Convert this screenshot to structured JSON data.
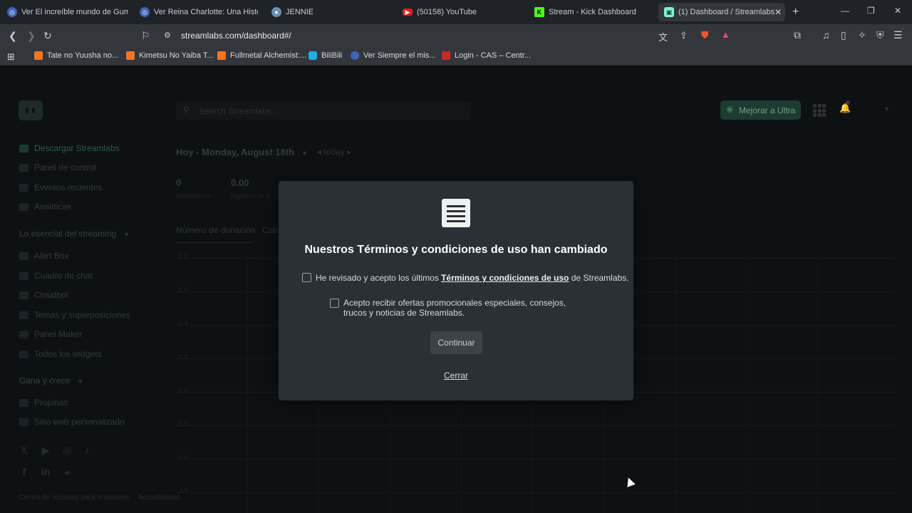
{
  "browser": {
    "tabs": [
      {
        "title": "Ver El increíble mundo de Gumb",
        "active": false
      },
      {
        "title": "Ver Reina Charlotte: Una Historia",
        "active": false
      },
      {
        "title": "JENNIE",
        "active": false
      },
      {
        "title": "(50158) YouTube",
        "active": false
      },
      {
        "title": "Stream - Kick Dashboard",
        "active": false
      },
      {
        "title": "(1) Dashboard / Streamlabs",
        "active": true
      }
    ],
    "url": "streamlabs.com/dashboard#/",
    "bookmarks": [
      "Tate no Yuusha no...",
      "Kimetsu No Yaiba T...",
      "Fullmetal Alchemist:...",
      "BiliBili",
      "Ver Siempre el mis...",
      "Login - CAS – Centr..."
    ]
  },
  "header": {
    "search_placeholder": "Search Streamlabs ...",
    "upgrade_label": "Mejorar a Ultra"
  },
  "sidebar": {
    "top_items": [
      {
        "label": "Descargar Streamlabs",
        "highlight": true
      },
      {
        "label": "Panel de control",
        "highlight": false
      },
      {
        "label": "Eventos recientes",
        "highlight": false
      },
      {
        "label": "Analíticas",
        "highlight": false
      }
    ],
    "section1_title": "Lo esencial del streaming",
    "section1_items": [
      "Alert Box",
      "Cuadro de chat",
      "Cloudbot",
      "Temas y superposiciones",
      "Panel Maker",
      "Todos los widgets"
    ],
    "section2_title": "Gana y crece",
    "section2_items": [
      "Propinas",
      "Sitio web personalizado"
    ],
    "footer_links": [
      "Centro de recursos para creadores",
      "Accesibilidad"
    ]
  },
  "main": {
    "date_label": "Hoy - Monday, August 18th",
    "today_label": "today",
    "stats": [
      {
        "value": "0",
        "label": "Donaciones"
      },
      {
        "value": "0.00",
        "label": "Ingresos de d"
      }
    ],
    "chart_tabs": [
      "Número de donación",
      "Can"
    ],
    "y_ticks": [
      "1.0",
      "0.9",
      "0.8",
      "0.7",
      "0.6",
      "0.5",
      "0.4",
      "0.3"
    ]
  },
  "modal": {
    "title": "Nuestros Términos y condiciones de uso han cambiado",
    "checkbox1_prefix": "He revisado y acepto los últimos ",
    "checkbox1_link": "Términos y condiciones de uso",
    "checkbox1_suffix": " de Streamlabs.",
    "checkbox2_text": "Acepto recibir ofertas promocionales especiales, consejos, trucos y noticias de Streamlabs.",
    "continue_label": "Continuar",
    "close_label": "Cerrar"
  }
}
